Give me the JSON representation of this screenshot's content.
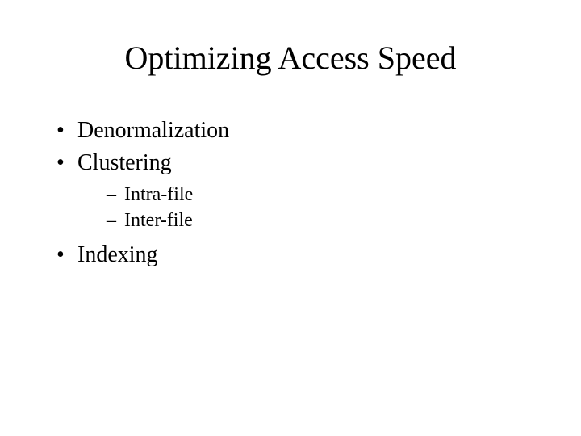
{
  "title": "Optimizing Access Speed",
  "bullets": {
    "item1": "Denormalization",
    "item2": "Clustering",
    "item2_sub1": "Intra-file",
    "item2_sub2": "Inter-file",
    "item3": "Indexing"
  }
}
